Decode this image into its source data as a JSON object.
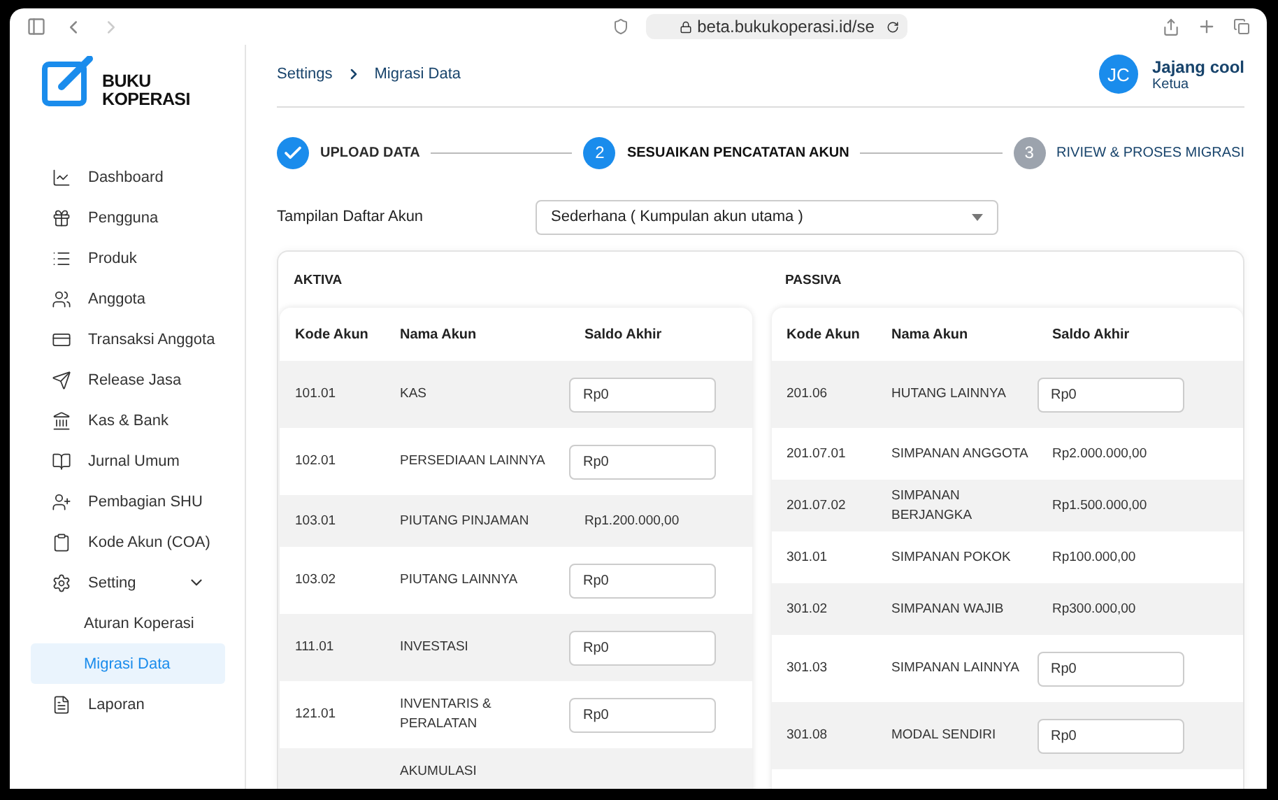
{
  "browser": {
    "url": "beta.bukukoperasi.id/se"
  },
  "logo": {
    "line_1": "BUKU",
    "line_2": "KOPERASI"
  },
  "sidebar": {
    "items": [
      {
        "label": "Dashboard",
        "selected": false
      },
      {
        "label": "Pengguna",
        "selected": false
      },
      {
        "label": "Produk",
        "selected": false
      },
      {
        "label": "Anggota",
        "selected": false
      },
      {
        "label": "Transaksi Anggota",
        "selected": false
      },
      {
        "label": "Release Jasa",
        "selected": false
      },
      {
        "label": "Kas & Bank",
        "selected": false
      },
      {
        "label": "Jurnal Umum",
        "selected": false
      },
      {
        "label": "Pembagian SHU",
        "selected": false
      },
      {
        "label": "Kode Akun (COA)",
        "selected": false
      },
      {
        "label": "Setting",
        "selected": false,
        "expanded": true,
        "children": [
          {
            "label": "Aturan Koperasi",
            "selected": false
          },
          {
            "label": "Migrasi Data",
            "selected": true
          }
        ]
      },
      {
        "label": "Laporan",
        "selected": false
      }
    ]
  },
  "breadcrumb": [
    "Settings",
    "Migrasi Data"
  ],
  "user": {
    "initials": "JC",
    "name": "Jajang cool",
    "role": "Ketua"
  },
  "steps": [
    {
      "label": "UPLOAD DATA",
      "completed": true,
      "selected": false
    },
    {
      "number": "2",
      "label": "SESUAIKAN PENCATATAN AKUN",
      "completed": false,
      "selected": true
    },
    {
      "number": "3",
      "label": "RIVIEW & PROSES MIGRASI",
      "completed": false,
      "selected": false
    }
  ],
  "account_view": {
    "label": "Tampilan Daftar Akun",
    "value": "Sederhana ( Kumpulan akun utama )"
  },
  "tables": [
    {
      "title": "AKTIVA",
      "columns": [
        "Kode Akun",
        "Nama Akun",
        "Saldo Akhir"
      ],
      "rows": [
        {
          "code": "101.01",
          "name": "KAS",
          "kind": "input",
          "saldo": "Rp0"
        },
        {
          "code": "102.01",
          "name": "PERSEDIAAN LAINNYA",
          "kind": "input",
          "saldo": "Rp0"
        },
        {
          "code": "103.01",
          "name": "PIUTANG PINJAMAN",
          "kind": "text",
          "saldo": "Rp1.200.000,00"
        },
        {
          "code": "103.02",
          "name": "PIUTANG LAINNYA",
          "kind": "input",
          "saldo": "Rp0"
        },
        {
          "code": "111.01",
          "name": "INVESTASI",
          "kind": "input",
          "saldo": "Rp0"
        },
        {
          "code": "121.01",
          "name": "INVENTARIS & PERALATAN",
          "kind": "input",
          "saldo": "Rp0"
        },
        {
          "name": "AKUMULASI",
          "kind": "partial"
        }
      ]
    },
    {
      "title": "PASSIVA",
      "columns": [
        "Kode Akun",
        "Nama Akun",
        "Saldo Akhir"
      ],
      "rows": [
        {
          "code": "201.06",
          "name": "HUTANG LAINNYA",
          "kind": "input",
          "saldo": "Rp0"
        },
        {
          "code": "201.07.01",
          "name": "SIMPANAN ANGGOTA",
          "kind": "text",
          "saldo": "Rp2.000.000,00"
        },
        {
          "code": "201.07.02",
          "name": "SIMPANAN BERJANGKA",
          "kind": "text",
          "saldo": "Rp1.500.000,00"
        },
        {
          "code": "301.01",
          "name": "SIMPANAN POKOK",
          "kind": "text",
          "saldo": "Rp100.000,00"
        },
        {
          "code": "301.02",
          "name": "SIMPANAN WAJIB",
          "kind": "text",
          "saldo": "Rp300.000,00"
        },
        {
          "code": "301.03",
          "name": "SIMPANAN LAINNYA",
          "kind": "input",
          "saldo": "Rp0"
        },
        {
          "code": "301.08",
          "name": "MODAL SENDIRI",
          "kind": "input",
          "saldo": "Rp0"
        }
      ]
    }
  ]
}
